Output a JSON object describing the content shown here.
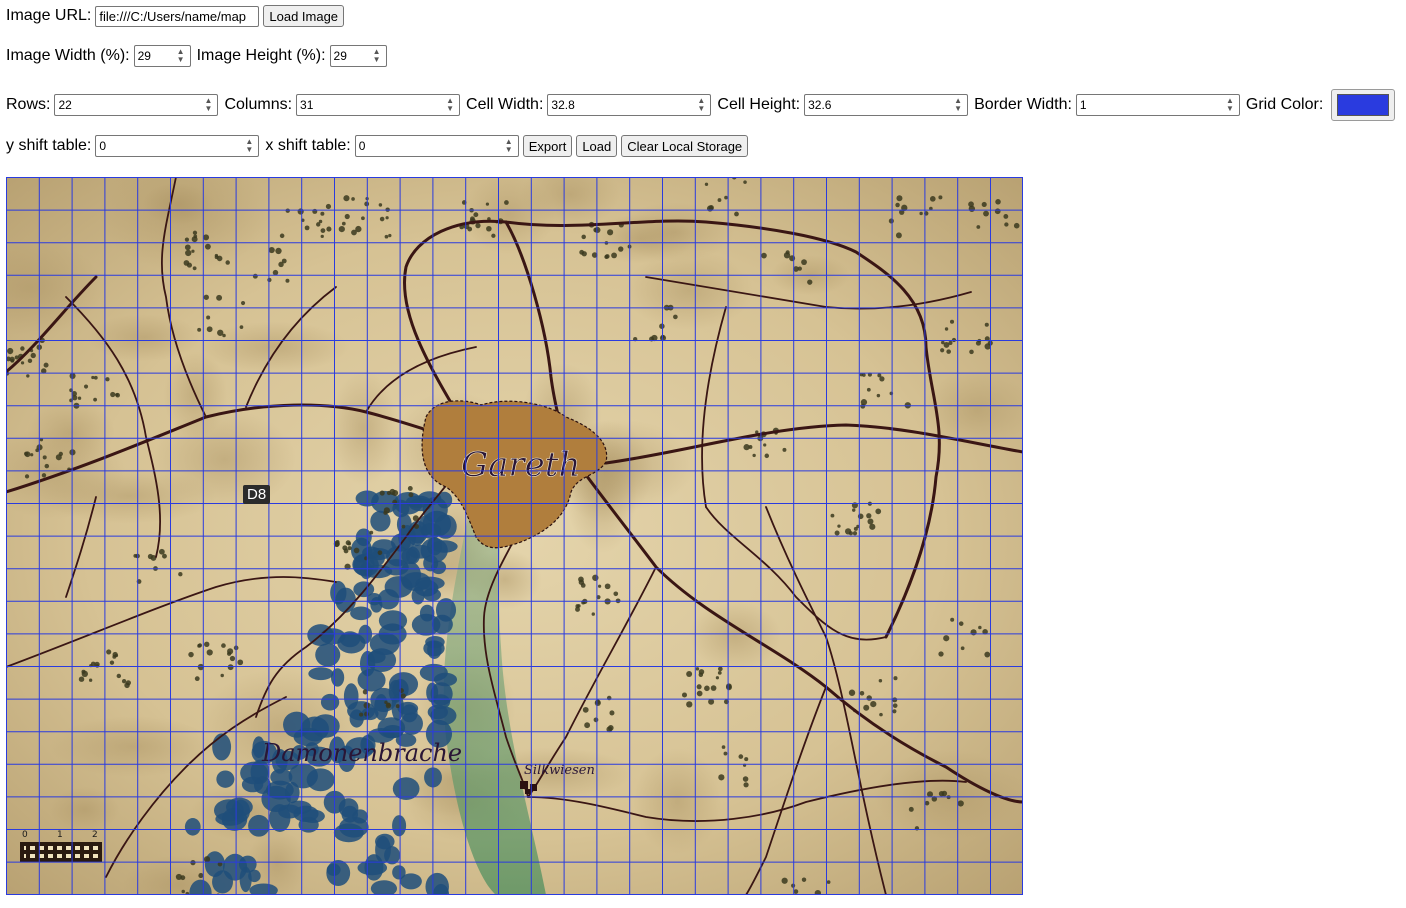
{
  "url_row": {
    "label": "Image URL:",
    "value": "file:///C:/Users/name/map",
    "button": "Load Image"
  },
  "size_row": {
    "width_label": "Image Width (%):",
    "width_value": "29",
    "height_label": "Image Height (%):",
    "height_value": "29"
  },
  "grid_row": {
    "rows_label": "Rows:",
    "rows_value": "22",
    "cols_label": "Columns:",
    "cols_value": "31",
    "cell_w_label": "Cell Width:",
    "cell_w_value": "32.8",
    "cell_h_label": "Cell Height:",
    "cell_h_value": "32.6",
    "border_label": "Border Width:",
    "border_value": "1",
    "color_label": "Grid Color:",
    "grid_color": "#2a3bdf"
  },
  "shift_row": {
    "y_label": "y shift table:",
    "y_value": "0",
    "x_label": "x shift table:",
    "x_value": "0",
    "export": "Export",
    "load": "Load",
    "clear": "Clear Local Storage"
  },
  "map": {
    "city": "Gareth",
    "region": "Damonenbrache",
    "village": "Silkwiesen",
    "cell_label": "D8",
    "scale_ticks": [
      "0",
      "1",
      "2"
    ],
    "parchment_color": "#d8c59a",
    "road_color": "#3a1614",
    "forest_color": "#1e4d7a",
    "city_color": "#b07e3d"
  }
}
